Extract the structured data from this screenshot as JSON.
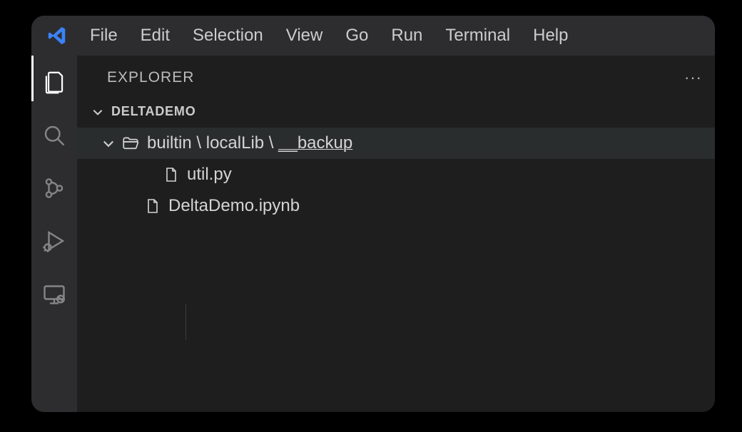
{
  "menu": {
    "file": "File",
    "edit": "Edit",
    "selection": "Selection",
    "view": "View",
    "go": "Go",
    "run": "Run",
    "terminal": "Terminal",
    "help": "Help"
  },
  "sidebar": {
    "title": "EXPLORER",
    "more": "···",
    "workspace": "DELTADEMO",
    "tree": {
      "folder_path": "builtin \\ localLib \\ __backup",
      "folder_segments": [
        "builtin",
        "localLib",
        "__backup"
      ],
      "file1": "util.py",
      "file2": "DeltaDemo.ipynb"
    }
  },
  "icons": {
    "vscode": "vscode-logo",
    "explorer": "files-icon",
    "search": "search-icon",
    "source": "source-control-icon",
    "debug": "debug-icon",
    "remote": "remote-icon",
    "folder_open": "folder-open-icon",
    "file": "file-icon",
    "chevron_down": "chevron-down-icon"
  },
  "colors": {
    "bg_window": "#1e1e1e",
    "bg_bar": "#2d2d30",
    "fg_primary": "#cccccc",
    "fg_muted": "#858585",
    "accent": "#3399ff"
  }
}
